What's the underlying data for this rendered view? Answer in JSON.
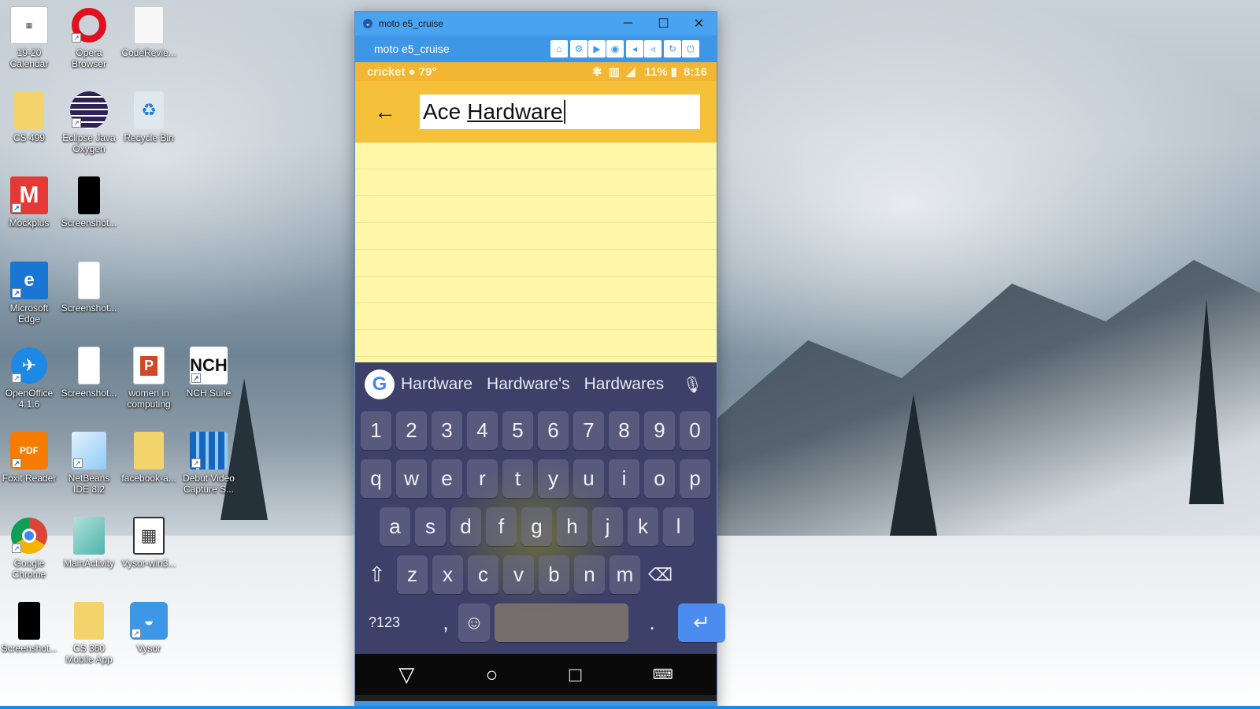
{
  "desktop": {
    "icons": [
      {
        "label": "19-20 Calendar",
        "icon": "calendar-file-icon"
      },
      {
        "label": "Opera Browser",
        "icon": "opera-icon"
      },
      {
        "label": "CodeRevie...",
        "icon": "file-icon"
      },
      {
        "label": "CS 499",
        "icon": "folder-icon"
      },
      {
        "label": "Eclipse Java Oxygen",
        "icon": "eclipse-icon"
      },
      {
        "label": "Recycle Bin",
        "icon": "recycle-bin-icon"
      },
      {
        "label": "Mockplus",
        "icon": "mockplus-icon"
      },
      {
        "label": "Screenshot...",
        "icon": "black-screenshot-icon"
      },
      {
        "label": "Microsoft Edge",
        "icon": "edge-icon"
      },
      {
        "label": "Screenshot...",
        "icon": "white-screenshot-icon"
      },
      {
        "label": "OpenOffice 4.1.6",
        "icon": "openoffice-icon"
      },
      {
        "label": "Screenshot...",
        "icon": "white-screenshot-icon"
      },
      {
        "label": "women in computing",
        "icon": "powerpoint-icon"
      },
      {
        "label": "NCH Suite",
        "icon": "nch-icon"
      },
      {
        "label": "Foxit Reader",
        "icon": "foxit-pdf-icon"
      },
      {
        "label": "NetBeans IDE 8.2",
        "icon": "netbeans-cube-icon"
      },
      {
        "label": "facebook-a...",
        "icon": "folder-icon"
      },
      {
        "label": "Debut Video Capture S...",
        "icon": "film-icon"
      },
      {
        "label": "Google Chrome",
        "icon": "chrome-icon"
      },
      {
        "label": "MainActivity",
        "icon": "document-icon"
      },
      {
        "label": "Vysor-win3...",
        "icon": "archive-icon"
      },
      {
        "label": "Screenshot...",
        "icon": "black-screenshot-icon"
      },
      {
        "label": "CS 360 Mobile App",
        "icon": "folder-icon"
      },
      {
        "label": "Vysor",
        "icon": "vysor-icon"
      }
    ]
  },
  "window": {
    "title": "moto e5_cruise",
    "vysor_device_name": "moto e5_cruise",
    "tools": [
      "cast-icon",
      "settings-icon",
      "video-icon",
      "camera-icon",
      "volume-down-icon",
      "volume-up-icon",
      "rotate-icon",
      "power-icon"
    ]
  },
  "phone": {
    "status": {
      "carrier": "cricket",
      "temp": "79°",
      "battery": "11%",
      "time": "8:16"
    },
    "search": {
      "word1": "Ace",
      "word2": "Hardware"
    },
    "suggestions": [
      "Hardware",
      "Hardware's",
      "Hardwares"
    ],
    "keys": {
      "numbers": [
        "1",
        "2",
        "3",
        "4",
        "5",
        "6",
        "7",
        "8",
        "9",
        "0"
      ],
      "row1": [
        "q",
        "w",
        "e",
        "r",
        "t",
        "y",
        "u",
        "i",
        "o",
        "p"
      ],
      "row2": [
        "a",
        "s",
        "d",
        "f",
        "g",
        "h",
        "j",
        "k",
        "l"
      ],
      "row3": [
        "z",
        "x",
        "c",
        "v",
        "b",
        "n",
        "m"
      ],
      "symbols_label": "?123",
      "comma": ",",
      "period": "."
    }
  },
  "colors": {
    "statusbar": "#f2b632",
    "appbar": "#f5c03a",
    "notepad": "#fff7a8",
    "titlebar": "#4aa3f0",
    "enter_key": "#4a8cf0"
  }
}
